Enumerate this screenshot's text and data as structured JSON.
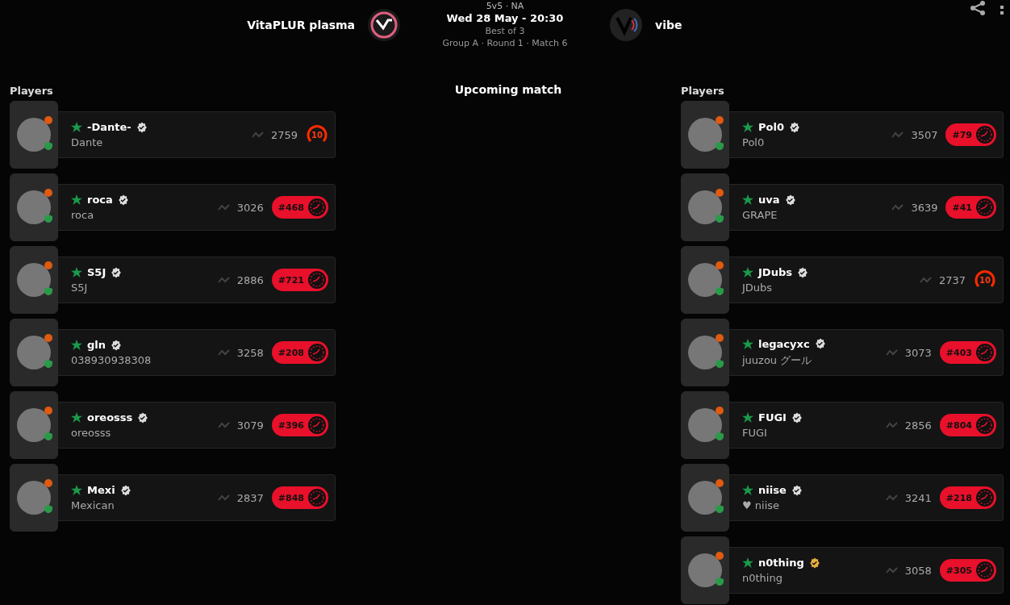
{
  "header": {
    "format": "5v5 · NA",
    "date": "Wed 28 May - 20:30",
    "best_of": "Best of 3",
    "stage": "Group A · Round 1 · Match 6",
    "team_left": {
      "name": "VitaPLUR plasma"
    },
    "team_right": {
      "name": "vibe"
    }
  },
  "center": {
    "title": "Upcoming match"
  },
  "teams": [
    {
      "heading": "Players",
      "players": [
        {
          "nickname": "-Dante-",
          "name": "Dante",
          "elo": "2759",
          "kind": "level",
          "badge": "10",
          "gold_verified": false
        },
        {
          "nickname": "roca",
          "name": "roca",
          "elo": "3026",
          "kind": "rank",
          "badge": "#468",
          "gold_verified": false
        },
        {
          "nickname": "S5J",
          "name": "S5J",
          "elo": "2886",
          "kind": "rank",
          "badge": "#721",
          "gold_verified": false
        },
        {
          "nickname": "gln",
          "name": "038930938308",
          "elo": "3258",
          "kind": "rank",
          "badge": "#208",
          "gold_verified": false
        },
        {
          "nickname": "oreosss",
          "name": "oreosss",
          "elo": "3079",
          "kind": "rank",
          "badge": "#396",
          "gold_verified": false
        },
        {
          "nickname": "Mexi",
          "name": "Mexican",
          "elo": "2837",
          "kind": "rank",
          "badge": "#848",
          "gold_verified": false
        }
      ]
    },
    {
      "heading": "Players",
      "players": [
        {
          "nickname": "Pol0",
          "name": "Pol0",
          "elo": "3507",
          "kind": "rank",
          "badge": "#79",
          "gold_verified": false
        },
        {
          "nickname": "uva",
          "name": "GRAPE",
          "elo": "3639",
          "kind": "rank",
          "badge": "#41",
          "gold_verified": false
        },
        {
          "nickname": "JDubs",
          "name": "JDubs",
          "elo": "2737",
          "kind": "level",
          "badge": "10",
          "gold_verified": false
        },
        {
          "nickname": "legacyxc",
          "name": "juuzou グール",
          "elo": "3073",
          "kind": "rank",
          "badge": "#403",
          "gold_verified": false
        },
        {
          "nickname": "FUGI",
          "name": "FUGI",
          "elo": "2856",
          "kind": "rank",
          "badge": "#804",
          "gold_verified": false
        },
        {
          "nickname": "niise",
          "name": "♥ niise",
          "elo": "3241",
          "kind": "rank",
          "badge": "#218",
          "gold_verified": false
        },
        {
          "nickname": "n0thing",
          "name": "n0thing",
          "elo": "3058",
          "kind": "rank",
          "badge": "#305",
          "gold_verified": true
        }
      ]
    }
  ]
}
